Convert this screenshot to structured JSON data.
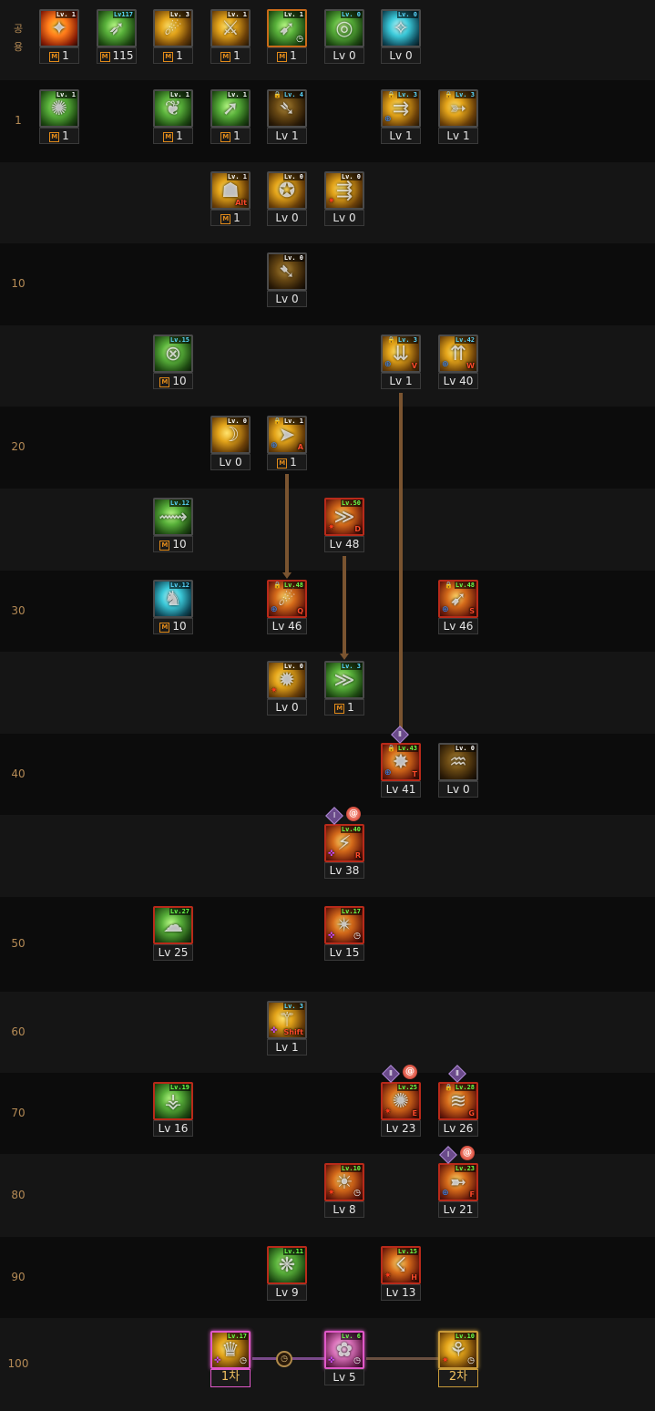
{
  "row_labels": [
    "공용",
    "1",
    "",
    "10",
    "",
    "20",
    "",
    "30",
    "",
    "40",
    "",
    "50",
    "60",
    "70",
    "80",
    "90",
    "100"
  ],
  "skills": [
    {
      "row": 0,
      "col": 0,
      "style": "g-fire",
      "glyph": "✦",
      "tag": "Lv. 1",
      "level": "1",
      "m": true
    },
    {
      "row": 0,
      "col": 1,
      "style": "g-green",
      "glyph": "➶",
      "tag": "Lv117",
      "tagc": "cyan",
      "level": "115",
      "m": true
    },
    {
      "row": 0,
      "col": 2,
      "style": "g-gold",
      "glyph": "☄",
      "tag": "Lv. 3",
      "level": "1",
      "m": true
    },
    {
      "row": 0,
      "col": 3,
      "style": "g-gold",
      "glyph": "⚔",
      "tag": "Lv. 1",
      "level": "1",
      "m": true
    },
    {
      "row": 0,
      "col": 4,
      "style": "g-green",
      "glyph": "➹",
      "tag": "Lv. 1",
      "level": "1",
      "m": true,
      "timer": true,
      "border": "border-orange"
    },
    {
      "row": 0,
      "col": 5,
      "style": "g-green",
      "glyph": "◎",
      "tag": "Lv. 0",
      "tagc": "cyan",
      "level": "Lv 0"
    },
    {
      "row": 0,
      "col": 6,
      "style": "g-cyan",
      "glyph": "✧",
      "tag": "Lv. 0",
      "tagc": "cyan",
      "level": "Lv 0"
    },
    {
      "row": 1,
      "col": 0,
      "style": "g-green",
      "glyph": "✺",
      "tag": "Lv. 1",
      "level": "1",
      "m": true
    },
    {
      "row": 1,
      "col": 2,
      "style": "g-green",
      "glyph": "❦",
      "tag": "Lv. 1",
      "level": "1",
      "m": true
    },
    {
      "row": 1,
      "col": 3,
      "style": "g-green",
      "glyph": "➚",
      "tag": "Lv. 1",
      "level": "1",
      "m": true
    },
    {
      "row": 1,
      "col": 4,
      "style": "g-dark",
      "glyph": "➴",
      "tag": "Lv. 4",
      "tagc": "cyan",
      "level": "Lv 1",
      "lock": true
    },
    {
      "row": 1,
      "col": 6,
      "style": "g-gold",
      "glyph": "⇉",
      "tag": "Lv. 3",
      "tagc": "cyan",
      "level": "Lv 1",
      "lock": true,
      "mark": "⊕",
      "markc": "blue"
    },
    {
      "row": 1,
      "col": 7,
      "style": "g-gold",
      "glyph": "➳",
      "tag": "Lv. 3",
      "tagc": "cyan",
      "level": "Lv 1",
      "lock": true
    },
    {
      "row": 2,
      "col": 3,
      "style": "g-gold",
      "glyph": "☗",
      "tag": "Lv. 1",
      "level": "1",
      "m": true,
      "key": "Alt"
    },
    {
      "row": 2,
      "col": 4,
      "style": "g-gold",
      "glyph": "✪",
      "tag": "Lv. 0",
      "level": "Lv 0"
    },
    {
      "row": 2,
      "col": 5,
      "style": "g-gold",
      "glyph": "⇶",
      "tag": "Lv. 0",
      "level": "Lv 0",
      "mark": "✷",
      "markc": "red"
    },
    {
      "row": 3,
      "col": 4,
      "style": "g-dark",
      "glyph": "➷",
      "tag": "Lv. 0",
      "level": "Lv 0"
    },
    {
      "row": 4,
      "col": 2,
      "style": "g-green",
      "glyph": "⊗",
      "tag": "Lv.15",
      "tagc": "cyan",
      "level": "10",
      "m": true
    },
    {
      "row": 4,
      "col": 6,
      "style": "g-gold",
      "glyph": "⇊",
      "tag": "Lv. 3",
      "tagc": "cyan",
      "level": "Lv 1",
      "lock": true,
      "mark": "⊕",
      "markc": "blue",
      "key": "V"
    },
    {
      "row": 4,
      "col": 7,
      "style": "g-gold",
      "glyph": "⇈",
      "tag": "Lv.42",
      "tagc": "cyan",
      "level": "Lv 40",
      "mark": "⊕",
      "markc": "blue",
      "key": "W"
    },
    {
      "row": 5,
      "col": 3,
      "style": "g-gold",
      "glyph": "☽",
      "tag": "Lv. 0",
      "level": "Lv 0"
    },
    {
      "row": 5,
      "col": 4,
      "style": "g-gold",
      "glyph": "➤",
      "tag": "Lv. 1",
      "level": "1",
      "m": true,
      "lock": true,
      "mark": "⊕",
      "markc": "blue",
      "key": "A"
    },
    {
      "row": 6,
      "col": 2,
      "style": "g-green",
      "glyph": "⟿",
      "tag": "Lv.12",
      "tagc": "cyan",
      "level": "10",
      "m": true
    },
    {
      "row": 6,
      "col": 5,
      "style": "g-red",
      "glyph": "≫",
      "tag": "Lv.50",
      "tagc": "green",
      "level": "Lv 48",
      "mark": "✷",
      "markc": "red",
      "key": "D",
      "border": "border-red"
    },
    {
      "row": 7,
      "col": 2,
      "style": "g-cyan",
      "glyph": "♞",
      "tag": "Lv.12",
      "tagc": "cyan",
      "level": "10",
      "m": true
    },
    {
      "row": 7,
      "col": 4,
      "style": "g-red",
      "glyph": "☄",
      "tag": "Lv.48",
      "tagc": "green",
      "level": "Lv 46",
      "lock": true,
      "mark": "⊕",
      "markc": "blue",
      "key": "Q",
      "border": "border-red"
    },
    {
      "row": 7,
      "col": 7,
      "style": "g-red",
      "glyph": "➹",
      "tag": "Lv.48",
      "tagc": "green",
      "level": "Lv 46",
      "lock": true,
      "mark": "⊕",
      "markc": "blue",
      "key": "S",
      "border": "border-red"
    },
    {
      "row": 8,
      "col": 4,
      "style": "g-gold",
      "glyph": "✹",
      "tag": "Lv. 0",
      "level": "Lv 0",
      "mark": "✷",
      "markc": "red"
    },
    {
      "row": 8,
      "col": 5,
      "style": "g-green",
      "glyph": "≫",
      "tag": "Lv. 3",
      "tagc": "cyan",
      "level": "1",
      "m": true
    },
    {
      "row": 9,
      "col": 6,
      "style": "g-red",
      "glyph": "✸",
      "tag": "Lv.43",
      "tagc": "green",
      "level": "Lv 41",
      "lock": true,
      "mark": "⊕",
      "markc": "blue",
      "key": "T",
      "border": "border-red"
    },
    {
      "row": 9,
      "col": 7,
      "style": "g-dark",
      "glyph": "♒",
      "tag": "Lv. 0",
      "level": "Lv 0"
    },
    {
      "row": 10,
      "col": 5,
      "style": "g-red",
      "glyph": "⚡",
      "tag": "Lv.40",
      "tagc": "green",
      "level": "Lv 38",
      "mark": "✜",
      "markc": "pink",
      "key": "R",
      "border": "border-red"
    },
    {
      "row": 11,
      "col": 2,
      "style": "g-green",
      "glyph": "☁",
      "tag": "Lv.27",
      "tagc": "green",
      "level": "Lv 25",
      "border": "border-red"
    },
    {
      "row": 11,
      "col": 5,
      "style": "g-red",
      "glyph": "✴",
      "tag": "Lv.17",
      "tagc": "green",
      "level": "Lv 15",
      "mark": "✜",
      "markc": "pink",
      "timer": true,
      "border": "border-red"
    },
    {
      "row": 12,
      "col": 4,
      "style": "g-gold",
      "glyph": "⚚",
      "tag": "Lv. 3",
      "tagc": "cyan",
      "level": "Lv 1",
      "mark": "✜",
      "markc": "pink",
      "key": "Shift"
    },
    {
      "row": 13,
      "col": 2,
      "style": "g-green",
      "glyph": "⚶",
      "tag": "Lv.19",
      "tagc": "green",
      "level": "Lv 16",
      "border": "border-red"
    },
    {
      "row": 13,
      "col": 6,
      "style": "g-red",
      "glyph": "✺",
      "tag": "Lv.25",
      "tagc": "green",
      "level": "Lv 23",
      "mark": "✷",
      "markc": "red",
      "key": "E",
      "border": "border-red"
    },
    {
      "row": 13,
      "col": 7,
      "style": "g-red",
      "glyph": "≋",
      "tag": "Lv.28",
      "tagc": "green",
      "level": "Lv 26",
      "lock": true,
      "key": "G",
      "border": "border-red"
    },
    {
      "row": 14,
      "col": 5,
      "style": "g-red",
      "glyph": "☀",
      "tag": "Lv.10",
      "tagc": "green",
      "level": "Lv 8",
      "mark": "✷",
      "markc": "red",
      "timer": true,
      "border": "border-red"
    },
    {
      "row": 14,
      "col": 7,
      "style": "g-red",
      "glyph": "➼",
      "tag": "Lv.23",
      "tagc": "green",
      "level": "Lv 21",
      "mark": "⊕",
      "markc": "blue",
      "key": "F",
      "border": "border-red"
    },
    {
      "row": 15,
      "col": 4,
      "style": "g-green",
      "glyph": "❋",
      "tag": "Lv.11",
      "tagc": "green",
      "level": "Lv 9",
      "border": "border-red"
    },
    {
      "row": 15,
      "col": 6,
      "style": "g-red",
      "glyph": "☇",
      "tag": "Lv.15",
      "tagc": "green",
      "level": "Lv 13",
      "mark": "✷",
      "markc": "red",
      "key": "H",
      "border": "border-red"
    },
    {
      "row": 16,
      "col": 3,
      "style": "g-gold",
      "glyph": "♛",
      "tag": "Lv.17",
      "tagc": "green",
      "level": "1차",
      "tier": true,
      "mark": "✜",
      "markc": "pink",
      "timer": true,
      "border": "border-pink"
    },
    {
      "row": 16,
      "col": 5,
      "style": "g-pink",
      "glyph": "✿",
      "tag": "Lv. 6",
      "tagc": "green",
      "level": "Lv 5",
      "mark": "✜",
      "markc": "pink",
      "timer": true,
      "border": "border-pink"
    },
    {
      "row": 16,
      "col": 7,
      "style": "g-gold",
      "glyph": "⚘",
      "tag": "Lv.10",
      "tagc": "green",
      "level": "2차",
      "tier": true,
      "mark": "✷",
      "markc": "red",
      "timer": true,
      "border": "border-gold"
    }
  ],
  "badges": [
    {
      "row": 9,
      "col": 6,
      "type": "diamond",
      "text": "Ⅱ",
      "pos": "top"
    },
    {
      "row": 10,
      "col": 5,
      "type": "diamond",
      "text": "Ⅰ",
      "pos": "topleft"
    },
    {
      "row": 10,
      "col": 5,
      "type": "swirl",
      "text": "@",
      "pos": "topright"
    },
    {
      "row": 13,
      "col": 6,
      "type": "diamond",
      "text": "Ⅱ",
      "pos": "topleft"
    },
    {
      "row": 13,
      "col": 6,
      "type": "swirl",
      "text": "@",
      "pos": "topright"
    },
    {
      "row": 13,
      "col": 7,
      "type": "diamond",
      "text": "Ⅱ",
      "pos": "top"
    },
    {
      "row": 14,
      "col": 7,
      "type": "diamond",
      "text": "Ⅰ",
      "pos": "topleft"
    },
    {
      "row": 14,
      "col": 7,
      "type": "swirl",
      "text": "@",
      "pos": "topright"
    }
  ],
  "links": [
    {
      "from_row": 5,
      "to_row": 7,
      "col": 4
    },
    {
      "from_row": 6,
      "to_row": 8,
      "col": 5
    },
    {
      "from_row": 4,
      "to_row": 9,
      "col": 6
    }
  ],
  "m_mark": "M",
  "lock_glyph": "🔒",
  "timer_glyph": "◷",
  "timer_node": "◷"
}
